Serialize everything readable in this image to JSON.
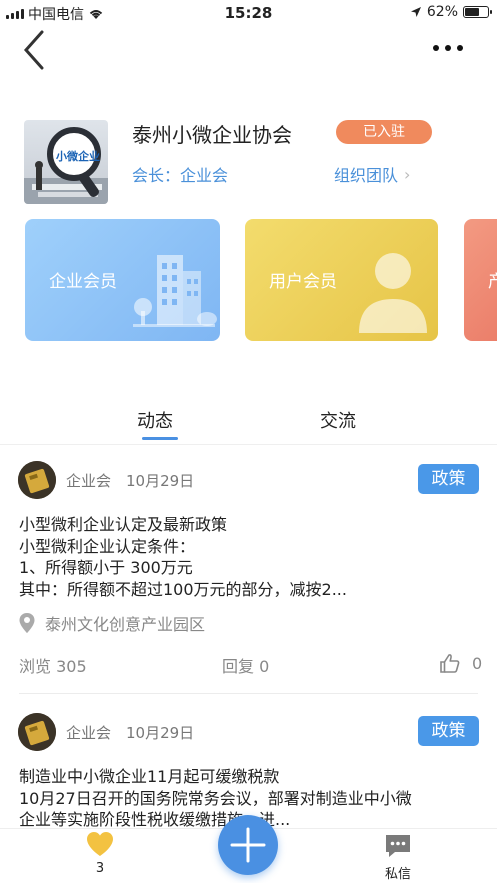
{
  "status_bar": {
    "carrier": "中国电信",
    "time": "15:28",
    "battery": "62%",
    "battery_level": 0.62
  },
  "nav": {
    "back_icon": "chevron-left-icon",
    "more_icon": "more-dots-icon"
  },
  "organization": {
    "name": "泰州小微企业协会",
    "status_badge": "已入驻",
    "president": "会长：企业会",
    "team_link": "组织团队",
    "logo_text": "小微企业",
    "colors": {
      "link": "#4a90d9",
      "badge": "#f08a5d"
    }
  },
  "cards": [
    {
      "label": "企业会员",
      "icon": "buildings-icon",
      "color": "#8fc3f7"
    },
    {
      "label": "用户会员",
      "icon": "user-icon",
      "color": "#eccf58"
    },
    {
      "label": "产",
      "icon": "",
      "color": "#ef8a72"
    }
  ],
  "tabs": {
    "active": "动态",
    "second": "交流"
  },
  "posts": [
    {
      "author": "企业会",
      "date": "10月29日",
      "tag": "政策",
      "lines": [
        "小型微利企业认定及最新政策",
        "小型微利企业认定条件：",
        "1、所得额小于 300万元",
        "其中：所得额不超过100万元的部分，减按2..."
      ],
      "location": "泰州文化创意产业园区",
      "views": "浏览 305",
      "replies": "回复 0",
      "likes": "0"
    },
    {
      "author": "企业会",
      "date": "10月29日",
      "tag": "政策",
      "lines": [
        "制造业中小微企业11月起可缓缴税款",
        "10月27日召开的国务院常务会议，部署对制造业中小微",
        "企业等实施阶段性税收缓缴措施，进..."
      ]
    }
  ],
  "tabbar": {
    "likes_count": "3",
    "messages_label": "私信",
    "fab_icon": "plus-icon",
    "accent": "#4a90e2"
  }
}
